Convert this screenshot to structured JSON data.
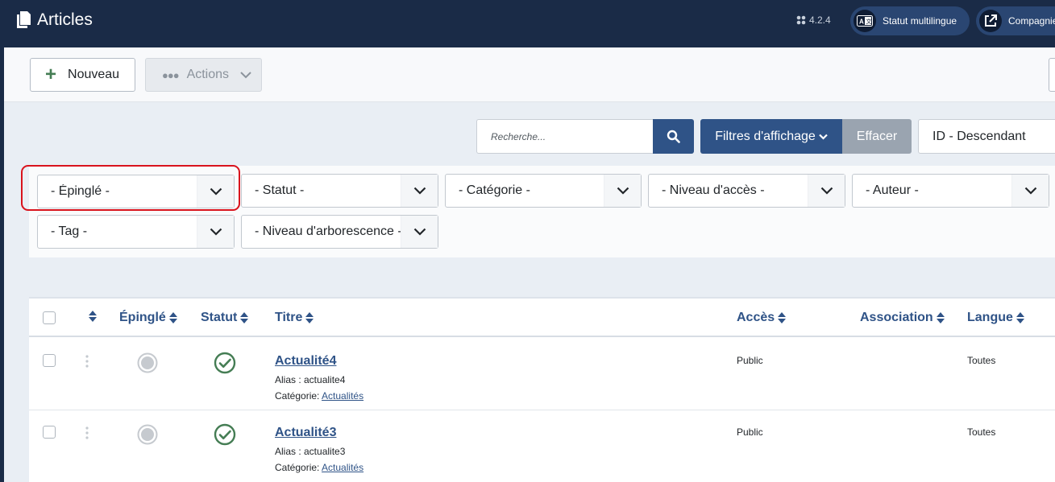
{
  "header": {
    "title": "Articles",
    "version": "4.2.4",
    "multilingual_label": "Statut multilingue",
    "company_label": "Compagnie"
  },
  "toolbar": {
    "new_label": "Nouveau",
    "actions_label": "Actions"
  },
  "search": {
    "placeholder": "Recherche...",
    "filters_label": "Filtres d'affichage",
    "clear_label": "Effacer",
    "ordering": "ID - Descendant"
  },
  "filters": {
    "pinned": "- Épinglé -",
    "status": "- Statut -",
    "category": "- Catégorie -",
    "access": "- Niveau d'accès -",
    "author": "- Auteur -",
    "tag": "- Tag -",
    "level": "- Niveau d'arborescence -"
  },
  "table": {
    "columns": {
      "pinned": "Épinglé",
      "status": "Statut",
      "title": "Titre",
      "access": "Accès",
      "association": "Association",
      "language": "Langue"
    },
    "rows": [
      {
        "title": "Actualité4",
        "alias_label": "Alias : actualite4",
        "category_label": "Catégorie:",
        "category": "Actualités",
        "access": "Public",
        "language": "Toutes"
      },
      {
        "title": "Actualité3",
        "alias_label": "Alias : actualite3",
        "category_label": "Catégorie:",
        "category": "Actualités",
        "access": "Public",
        "language": "Toutes"
      }
    ]
  },
  "colors": {
    "header_bg": "#1a2b47",
    "primary": "#2f5387",
    "success": "#457d54",
    "highlight": "#d9131d"
  },
  "icons": [
    "articles-icon",
    "joomla-icon",
    "language-icon",
    "external-link-icon",
    "plus-icon",
    "ellipsis-icon",
    "chevron-down-icon",
    "search-icon",
    "sort-icon",
    "drag-handle-icon",
    "unpinned-icon",
    "published-check-icon"
  ]
}
